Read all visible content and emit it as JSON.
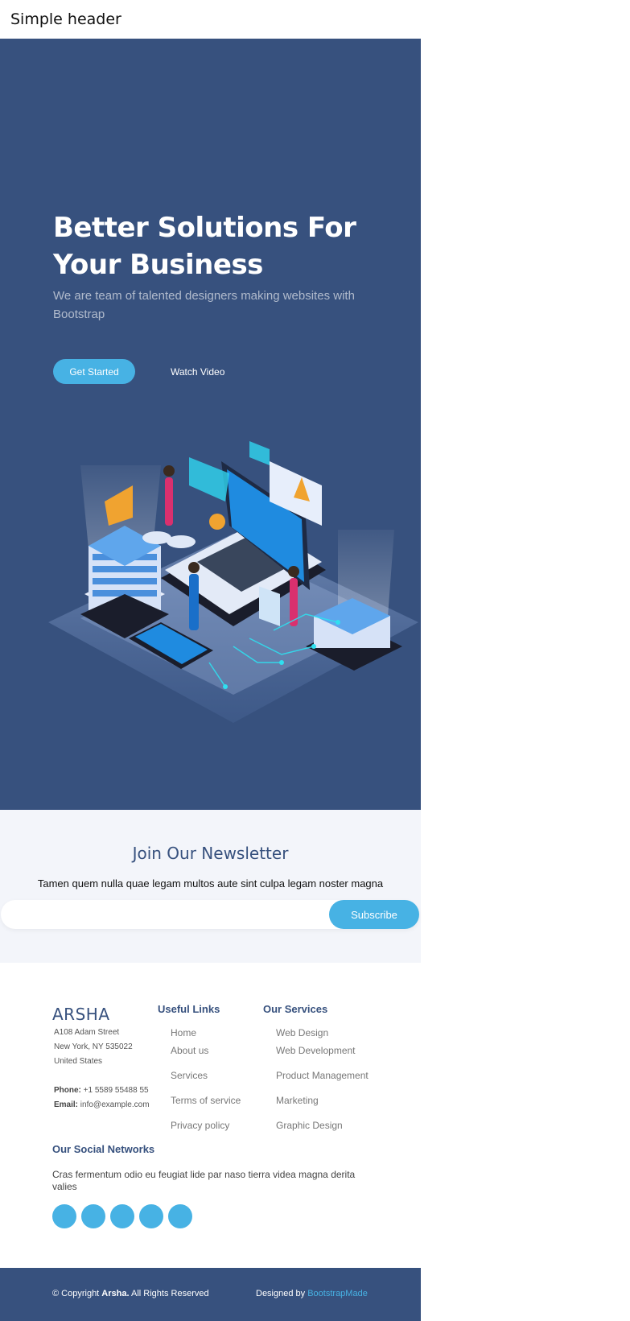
{
  "topbar": {
    "title": "Simple header"
  },
  "hero": {
    "headline": "Better Solutions For Your Business",
    "subtitle": "We are team of talented designers making websites with Bootstrap",
    "primary_cta": "Get Started",
    "secondary_cta": "Watch Video"
  },
  "newsletter": {
    "title": "Join Our Newsletter",
    "text": "Tamen quem nulla quae legam multos aute sint culpa legam noster magna",
    "input_value": "",
    "button": "Subscribe"
  },
  "footer": {
    "brand": "ARSHA",
    "address": [
      "A108 Adam Street",
      "New York, NY 535022",
      "United States"
    ],
    "phone_label": "Phone:",
    "phone": "+1 5589 55488 55",
    "email_label": "Email:",
    "email": "info@example.com",
    "useful_links": {
      "title": "Useful Links",
      "items": [
        "Home",
        "About us",
        "Services",
        "Terms of service",
        "Privacy policy"
      ]
    },
    "services": {
      "title": "Our Services",
      "items": [
        "Web Design",
        "Web Development",
        "Product Management",
        "Marketing",
        "Graphic Design"
      ]
    },
    "social": {
      "title": "Our Social Networks",
      "text": "Cras fermentum odio eu feugiat lide par naso tierra videa magna derita valies"
    }
  },
  "bottom": {
    "copyright_prefix": "© Copyright ",
    "copyright_brand": "Arsha.",
    "copyright_suffix": " All Rights Reserved",
    "designed_by": "Designed by ",
    "designer": "BootstrapMade"
  },
  "colors": {
    "primary": "#37517e",
    "accent": "#47b2e4",
    "section_bg": "#f3f5fa"
  }
}
